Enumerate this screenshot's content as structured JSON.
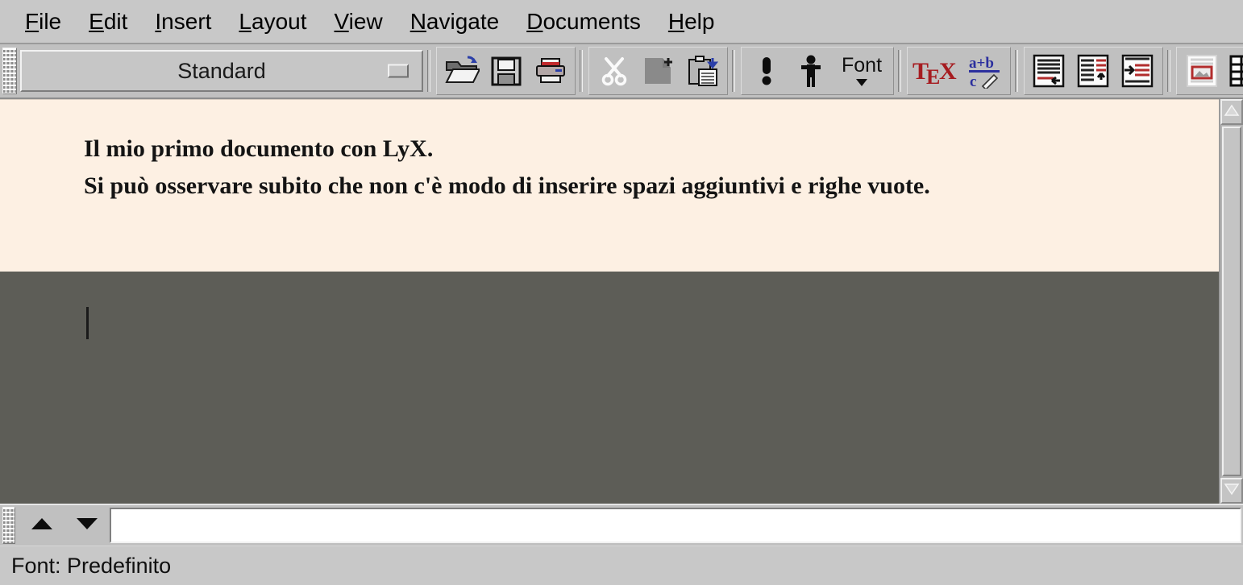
{
  "menubar": {
    "items": [
      {
        "mnemonic": "F",
        "rest": "ile"
      },
      {
        "mnemonic": "E",
        "rest": "dit"
      },
      {
        "mnemonic": "I",
        "rest": "nsert"
      },
      {
        "mnemonic": "L",
        "rest": "ayout"
      },
      {
        "mnemonic": "V",
        "rest": "iew"
      },
      {
        "mnemonic": "N",
        "rest": "avigate"
      },
      {
        "mnemonic": "D",
        "rest": "ocuments"
      },
      {
        "mnemonic": "H",
        "rest": "elp"
      }
    ]
  },
  "toolbar": {
    "layout_combo": {
      "value": "Standard",
      "name": "layout-style-combobox"
    },
    "groups": [
      {
        "name": "file-group",
        "buttons": [
          {
            "icon": "open-document-icon",
            "tooltip": "Open document"
          },
          {
            "icon": "save-document-icon",
            "tooltip": "Save document"
          },
          {
            "icon": "print-document-icon",
            "tooltip": "Print document"
          }
        ]
      },
      {
        "name": "clipboard-group",
        "buttons": [
          {
            "icon": "cut-icon",
            "tooltip": "Cut"
          },
          {
            "icon": "copy-icon",
            "tooltip": "Copy"
          },
          {
            "icon": "paste-icon",
            "tooltip": "Paste"
          }
        ]
      },
      {
        "name": "tools-group",
        "buttons": [
          {
            "icon": "spellcheck-icon",
            "tooltip": "Check spelling"
          },
          {
            "icon": "thesaurus-person-icon",
            "tooltip": "Thesaurus"
          },
          {
            "icon": "font-dropdown-icon",
            "tooltip": "Font",
            "label": "Font"
          }
        ]
      },
      {
        "name": "insert-math-group",
        "buttons": [
          {
            "icon": "tex-mode-icon",
            "tooltip": "TeX mode",
            "label": "TeX"
          },
          {
            "icon": "math-formula-icon",
            "tooltip": "Insert math formula"
          }
        ]
      },
      {
        "name": "notes-group",
        "buttons": [
          {
            "icon": "footnote-icon",
            "tooltip": "Insert footnote"
          },
          {
            "icon": "margin-note-icon",
            "tooltip": "Insert margin note"
          },
          {
            "icon": "indent-list-icon",
            "tooltip": "Insert list / indent"
          }
        ]
      },
      {
        "name": "objects-group",
        "buttons": [
          {
            "icon": "insert-graphics-icon",
            "tooltip": "Insert graphics"
          },
          {
            "icon": "insert-table-icon",
            "tooltip": "Insert table"
          }
        ]
      }
    ]
  },
  "document": {
    "lines": "Il mio primo documento con LyX.\nSi può osservare subito che non c'è modo di inserire spazi aggiuntivi e righe vuote.",
    "background_color": "#fdf0e3",
    "outside_color": "#5d5d57"
  },
  "minibuffer": {
    "value": "",
    "placeholder": ""
  },
  "bottom_toolbar": {
    "up_button": "scroll-up-triangle",
    "down_button": "scroll-down-triangle"
  },
  "statusbar": {
    "text": "Font: Predefinito"
  },
  "colors": {
    "chrome": "#c0c0c0",
    "menubar": "#c8c8c8",
    "paper": "#fdf0e3",
    "canvas": "#5d5d57",
    "tex_red": "#a61c20",
    "math_blue": "#2b2f9e"
  }
}
